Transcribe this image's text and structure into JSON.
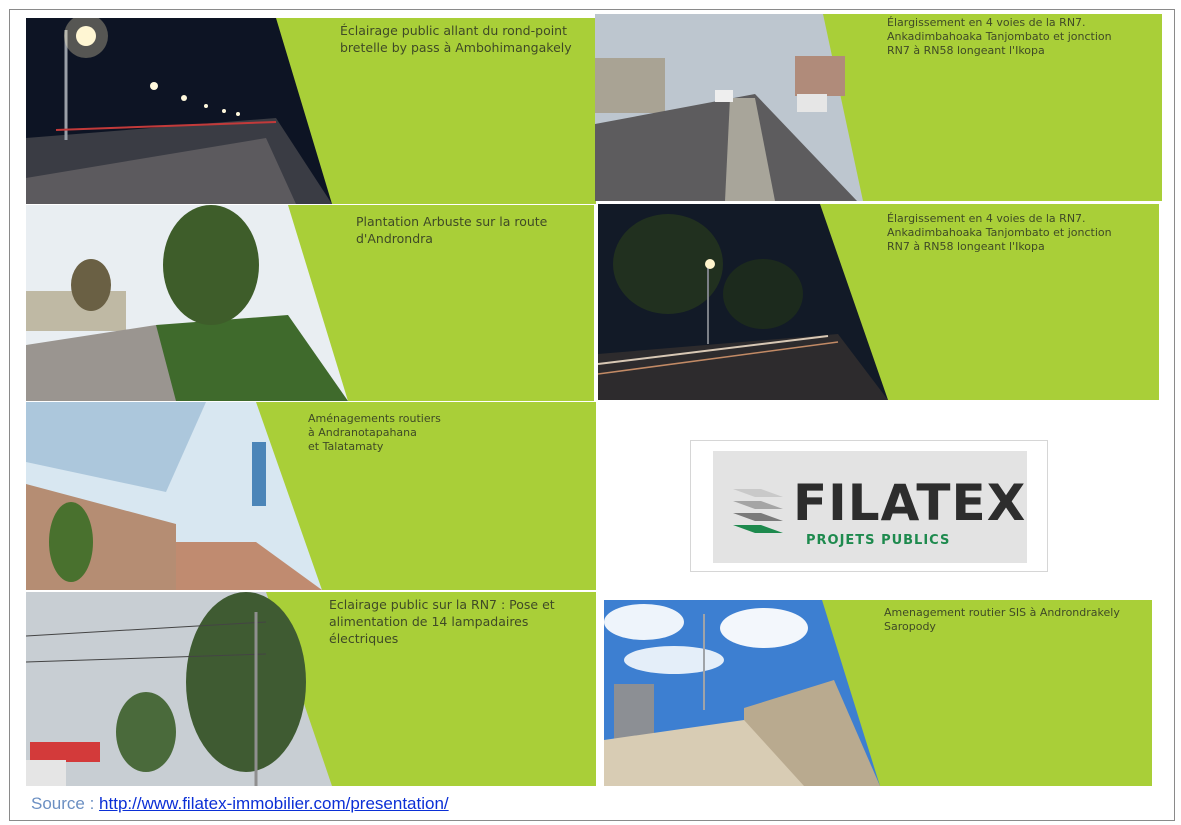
{
  "tiles": [
    {
      "caption": "Éclairage public allant du rond-point\nbretelle by pass à Ambohimangakely"
    },
    {
      "caption": "Élargissement en 4 voies de la RN7.\nAnkadimbahoaka Tanjombato et jonction\nRN7 à RN58 longeant l'Ikopa"
    },
    {
      "caption": "Plantation Arbuste sur la route\nd'Androndra"
    },
    {
      "caption": "Élargissement en 4 voies de la RN7.\nAnkadimbahoaka Tanjombato et jonction\nRN7 à RN58 longeant l'Ikopa"
    },
    {
      "caption": "Aménagements routiers\nà Andranotapahana\net Talatamaty"
    },
    {
      "caption": "Eclairage public  sur la RN7 : Pose et\nalimentation de 14 lampadaires\nélectriques"
    },
    {
      "caption": "Amenagement routier SIS à Androndrakely\nSaropody"
    }
  ],
  "logo": {
    "word": "FILATEX",
    "subtitle": "PROJETS PUBLICS"
  },
  "source": {
    "label": "Source : ",
    "link_text": "http://www.filatex-immobilier.com/presentation/"
  },
  "colors": {
    "panel_green": "#a9cf38",
    "link_blue": "#0b2fd6",
    "logo_green": "#1e8a4e"
  }
}
